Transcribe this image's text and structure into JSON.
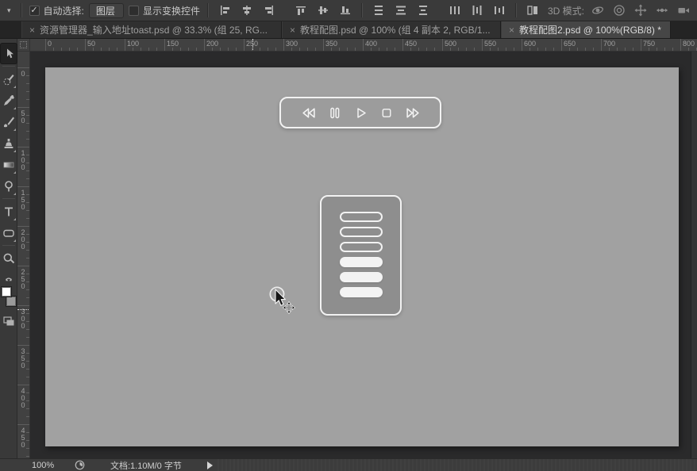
{
  "colors": {
    "canvas_gray": "#a1a1a1",
    "panel_gray": "#8e8e8e",
    "stroke_white": "#f2f2f2",
    "chrome_dark": "#3a3a3a",
    "foreground_swatch": "#ffffff",
    "background_swatch": "#9a9a9a"
  },
  "options_bar": {
    "auto_select_label": "自动选择:",
    "auto_select_checked": true,
    "check_glyph": "✓",
    "layer_select_value": "图层",
    "show_transform_label": "显示变换控件",
    "show_transform_checked": false,
    "align_icons": [
      "align-left-edges-icon",
      "align-horizontal-centers-icon",
      "align-right-edges-icon",
      "align-top-edges-icon",
      "align-vertical-centers-icon",
      "align-bottom-edges-icon"
    ],
    "distribute_icons": [
      "distribute-top-edges-icon",
      "distribute-vertical-centers-icon",
      "distribute-bottom-edges-icon",
      "distribute-left-edges-icon",
      "distribute-horizontal-centers-icon",
      "distribute-right-edges-icon"
    ],
    "auto_align_icon": "auto-align-layers-icon",
    "mode_3d_label": "3D 模式:",
    "icons_3d": [
      "3d-rotate-icon",
      "3d-roll-icon",
      "3d-drag-icon",
      "3d-slide-icon",
      "3d-camera-icon"
    ]
  },
  "tabs": [
    {
      "title": "资源管理器_输入地址toast.psd @ 33.3% (组 25, RG...",
      "active": false
    },
    {
      "title": "教程配图.psd @ 100% (组 4 副本 2, RGB/1...",
      "active": false
    },
    {
      "title": "教程配图2.psd @ 100%(RGB/8) *",
      "active": true
    }
  ],
  "tools": [
    {
      "name": "move-tool",
      "selected": true,
      "sep_after": true,
      "flyout": false
    },
    {
      "name": "quick-selection-tool",
      "selected": false,
      "sep_after": false,
      "flyout": true
    },
    {
      "name": "eyedropper-tool",
      "selected": false,
      "sep_after": false,
      "flyout": true
    },
    {
      "name": "brush-tool",
      "selected": false,
      "sep_after": false,
      "flyout": true
    },
    {
      "name": "clone-stamp-tool",
      "selected": false,
      "sep_after": false,
      "flyout": true
    },
    {
      "name": "gradient-tool",
      "selected": false,
      "sep_after": false,
      "flyout": true
    },
    {
      "name": "dodge-tool",
      "selected": false,
      "sep_after": true,
      "flyout": true
    },
    {
      "name": "type-tool",
      "selected": false,
      "sep_after": false,
      "flyout": true
    },
    {
      "name": "rounded-rectangle-tool",
      "selected": false,
      "sep_after": true,
      "flyout": true
    },
    {
      "name": "zoom-tool",
      "selected": false,
      "sep_after": false,
      "flyout": false
    }
  ],
  "rulers": {
    "h_labels": [
      "0",
      "50",
      "100",
      "150",
      "200",
      "250",
      "300",
      "350",
      "400",
      "450",
      "500",
      "550",
      "600",
      "650",
      "700",
      "750",
      "800"
    ],
    "v_labels": [
      "0",
      "50",
      "100",
      "150",
      "200",
      "250",
      "300",
      "350",
      "400",
      "450"
    ]
  },
  "canvas": {
    "player_buttons": [
      "rewind",
      "pause",
      "play",
      "stop",
      "fast-forward"
    ],
    "list_bars": [
      "outline",
      "outline",
      "outline",
      "filled",
      "filled",
      "filled"
    ]
  },
  "status_bar": {
    "zoom_level": "100%",
    "doc_info": "文档:1.10M/0 字节"
  }
}
